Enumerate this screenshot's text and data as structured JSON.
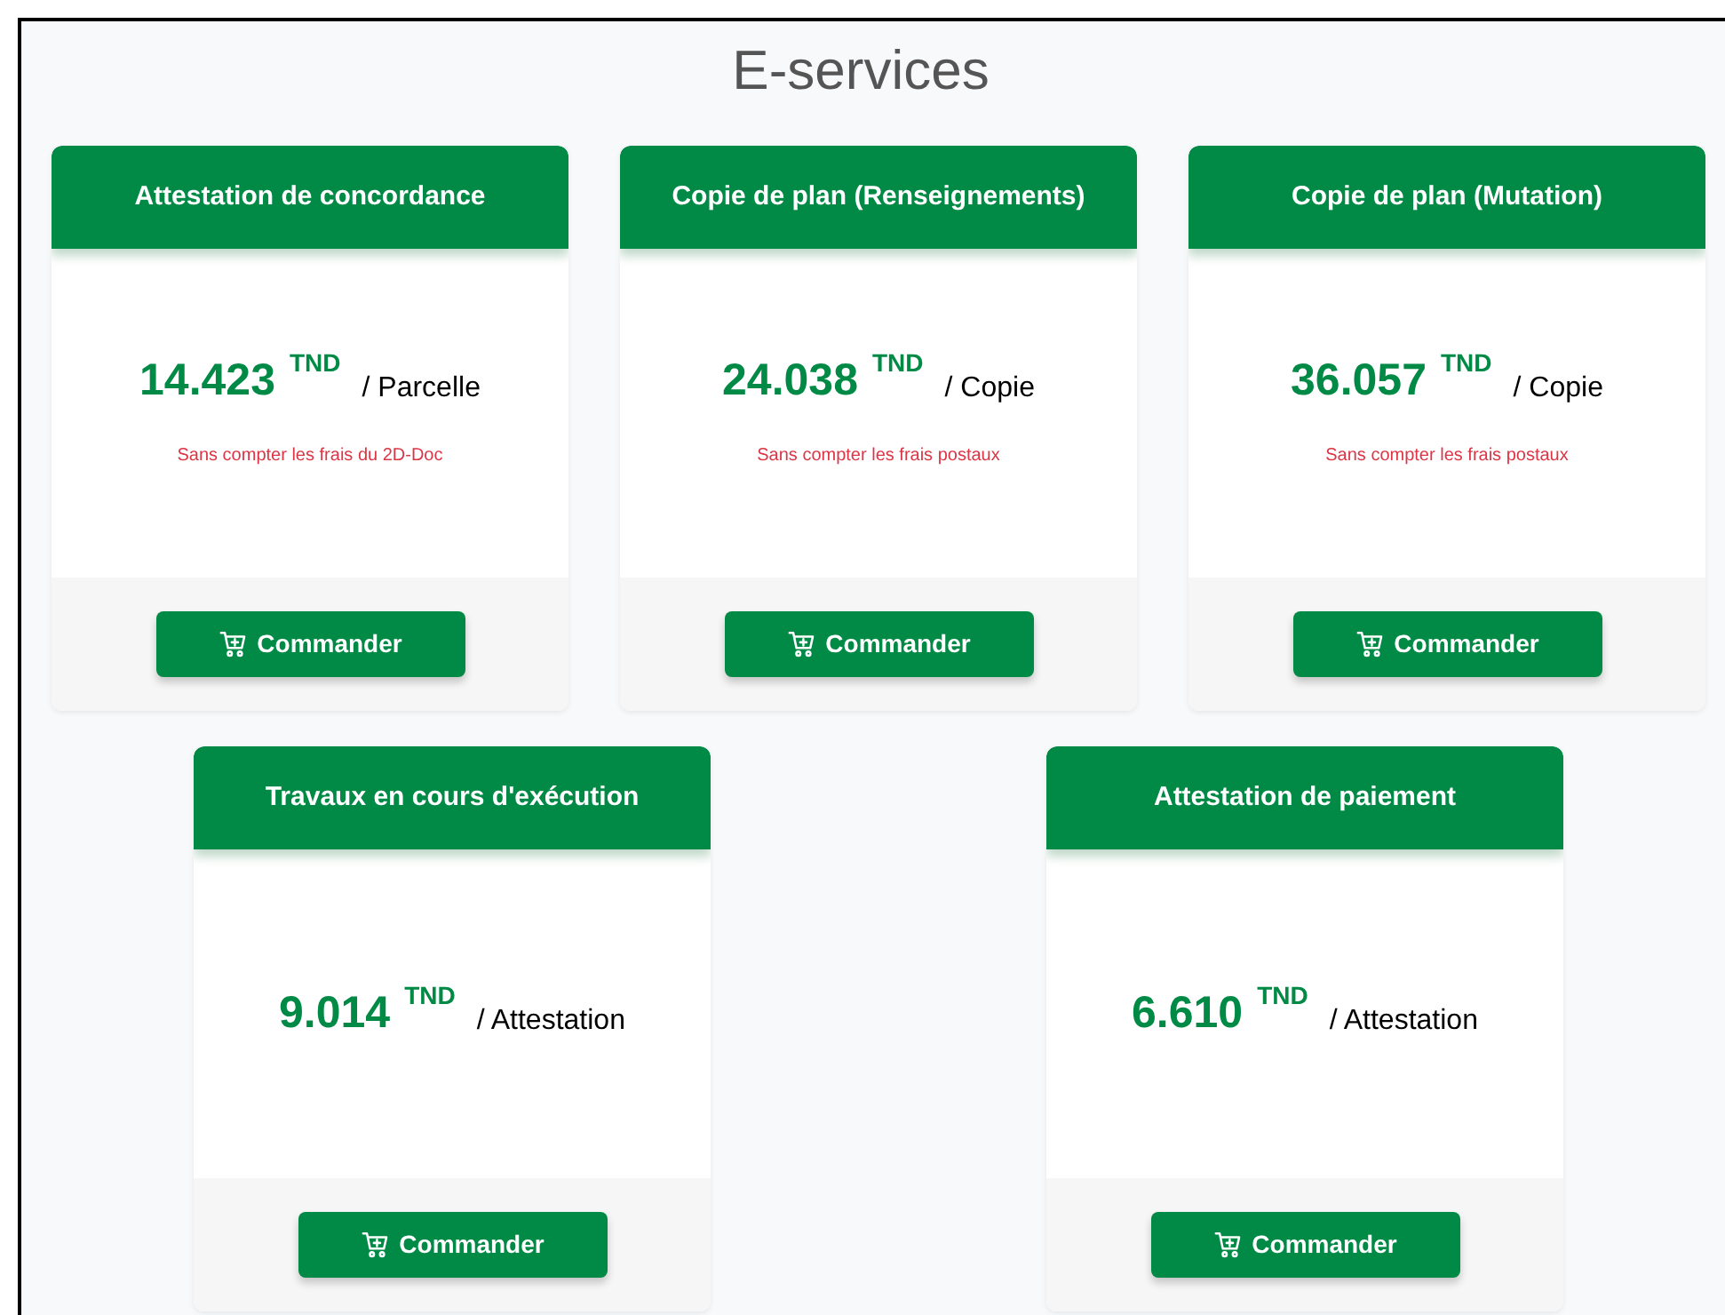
{
  "page_title": "E-services",
  "services": [
    {
      "title": "Attestation de concordance",
      "price": "14.423",
      "currency": "TND",
      "unit": "/ Parcelle",
      "note": "Sans compter les frais du 2D-Doc",
      "button": "Commander"
    },
    {
      "title": "Copie de plan (Renseignements)",
      "price": "24.038",
      "currency": "TND",
      "unit": "/ Copie",
      "note": "Sans compter les frais postaux",
      "button": "Commander"
    },
    {
      "title": "Copie de plan (Mutation)",
      "price": "36.057",
      "currency": "TND",
      "unit": "/ Copie",
      "note": "Sans compter les frais postaux",
      "button": "Commander"
    },
    {
      "title": "Travaux en cours d'exécution",
      "price": "9.014",
      "currency": "TND",
      "unit": "/ Attestation",
      "button": "Commander"
    },
    {
      "title": "Attestation de paiement",
      "price": "6.610",
      "currency": "TND",
      "unit": "/ Attestation",
      "button": "Commander"
    }
  ]
}
